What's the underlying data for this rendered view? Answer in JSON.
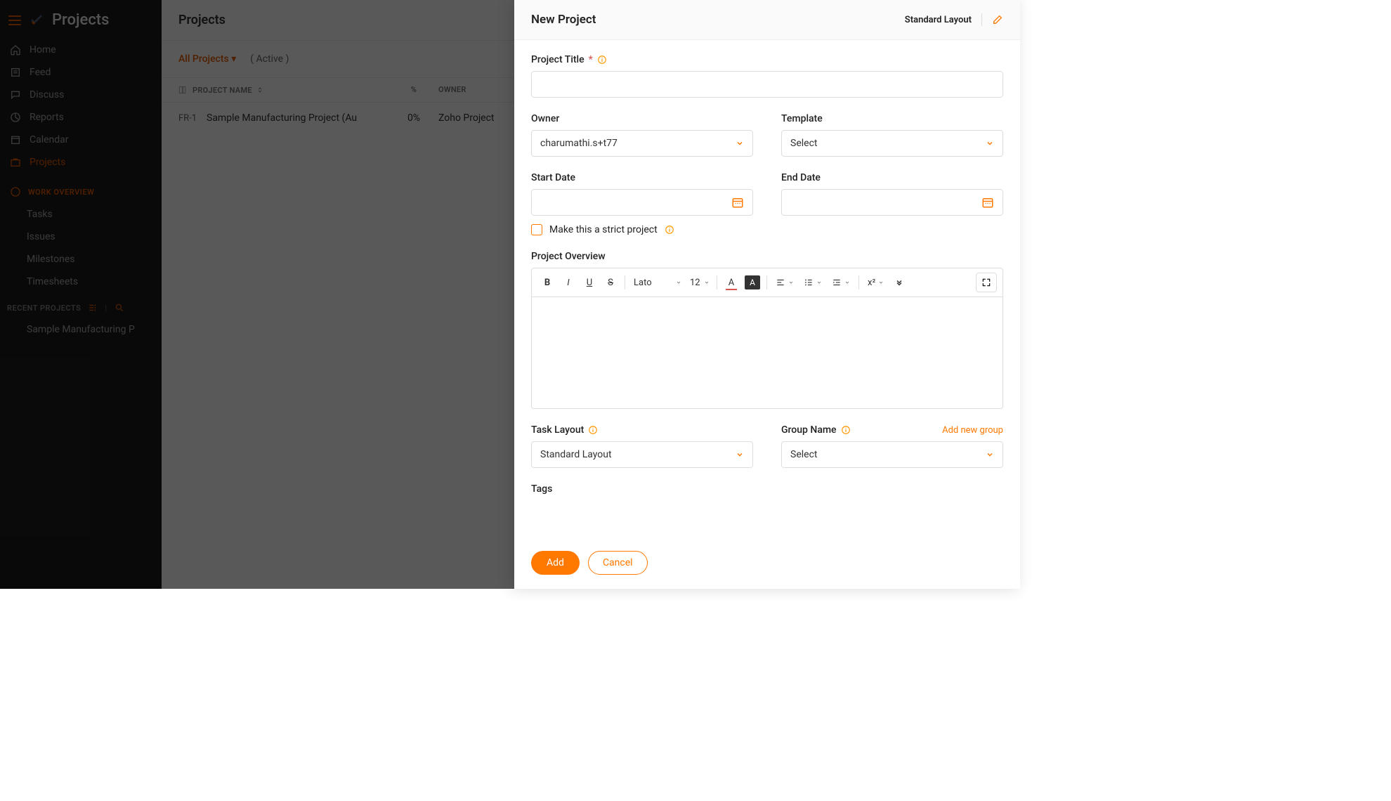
{
  "app": {
    "brand": "Projects",
    "nav": {
      "home": "Home",
      "feed": "Feed",
      "discuss": "Discuss",
      "reports": "Reports",
      "calendar": "Calendar",
      "projects": "Projects"
    },
    "work_overview_header": "WORK OVERVIEW",
    "work_overview": {
      "tasks": "Tasks",
      "issues": "Issues",
      "milestones": "Milestones",
      "timesheets": "Timesheets"
    },
    "recent_header": "RECENT PROJECTS",
    "recent_item": "Sample Manufacturing P"
  },
  "main": {
    "title": "Projects",
    "filter_scope": "All Projects",
    "filter_status": "( Active )",
    "columns": {
      "name": "PROJECT NAME",
      "pct": "%",
      "owner": "OWNER"
    },
    "row": {
      "id": "FR-1",
      "name": "Sample Manufacturing Project (Au",
      "pct": "0%",
      "owner": "Zoho Project"
    }
  },
  "modal": {
    "title": "New Project",
    "header_layout": "Standard Layout",
    "labels": {
      "project_title": "Project Title",
      "owner": "Owner",
      "template": "Template",
      "start_date": "Start Date",
      "end_date": "End Date",
      "strict": "Make this a strict project",
      "overview": "Project Overview",
      "task_layout": "Task Layout",
      "group_name": "Group Name",
      "tags": "Tags",
      "add_group": "Add new group"
    },
    "values": {
      "owner": "charumathi.s+t77",
      "template": "Select",
      "task_layout": "Standard Layout",
      "group_name": "Select"
    },
    "rte": {
      "font": "Lato",
      "size": "12",
      "super": "x²"
    },
    "buttons": {
      "add": "Add",
      "cancel": "Cancel"
    }
  }
}
